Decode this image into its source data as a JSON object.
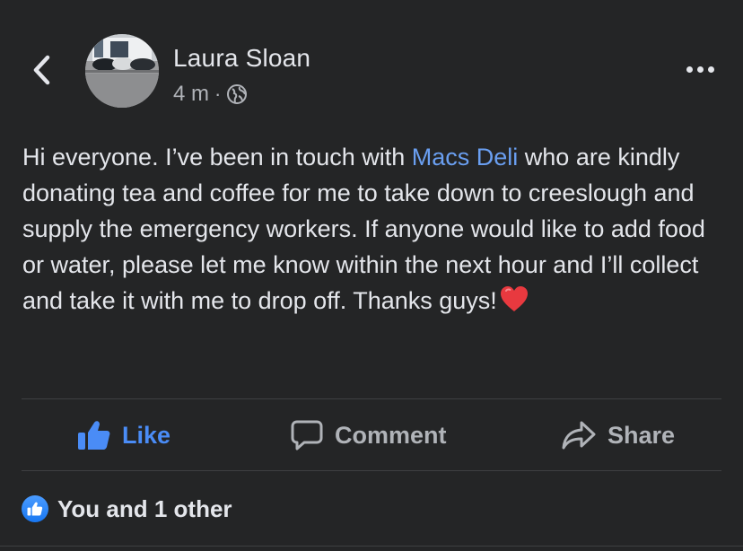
{
  "post": {
    "author": "Laura Sloan",
    "time": "4 m",
    "separator": "·",
    "audience_icon": "globe-icon",
    "text_before_link": "Hi everyone. I’ve been in touch with ",
    "link_text": "Macs Deli",
    "text_after_link": " who are kindly donating tea and coffee for me to take down to creeslough and supply the emergency workers. If anyone would like to add food or water, please let me know within the next hour and I’ll collect and take it with me to drop off. Thanks guys!",
    "emoji": "heart-icon"
  },
  "actions": {
    "like": "Like",
    "comment": "Comment",
    "share": "Share"
  },
  "reactions": {
    "summary": "You and 1 other"
  },
  "colors": {
    "background": "#242526",
    "text": "#e4e6eb",
    "secondary_text": "#b0b3b8",
    "link": "#6a9ff1",
    "like_blue": "#4a8cf6",
    "heart": "#e8393f"
  }
}
